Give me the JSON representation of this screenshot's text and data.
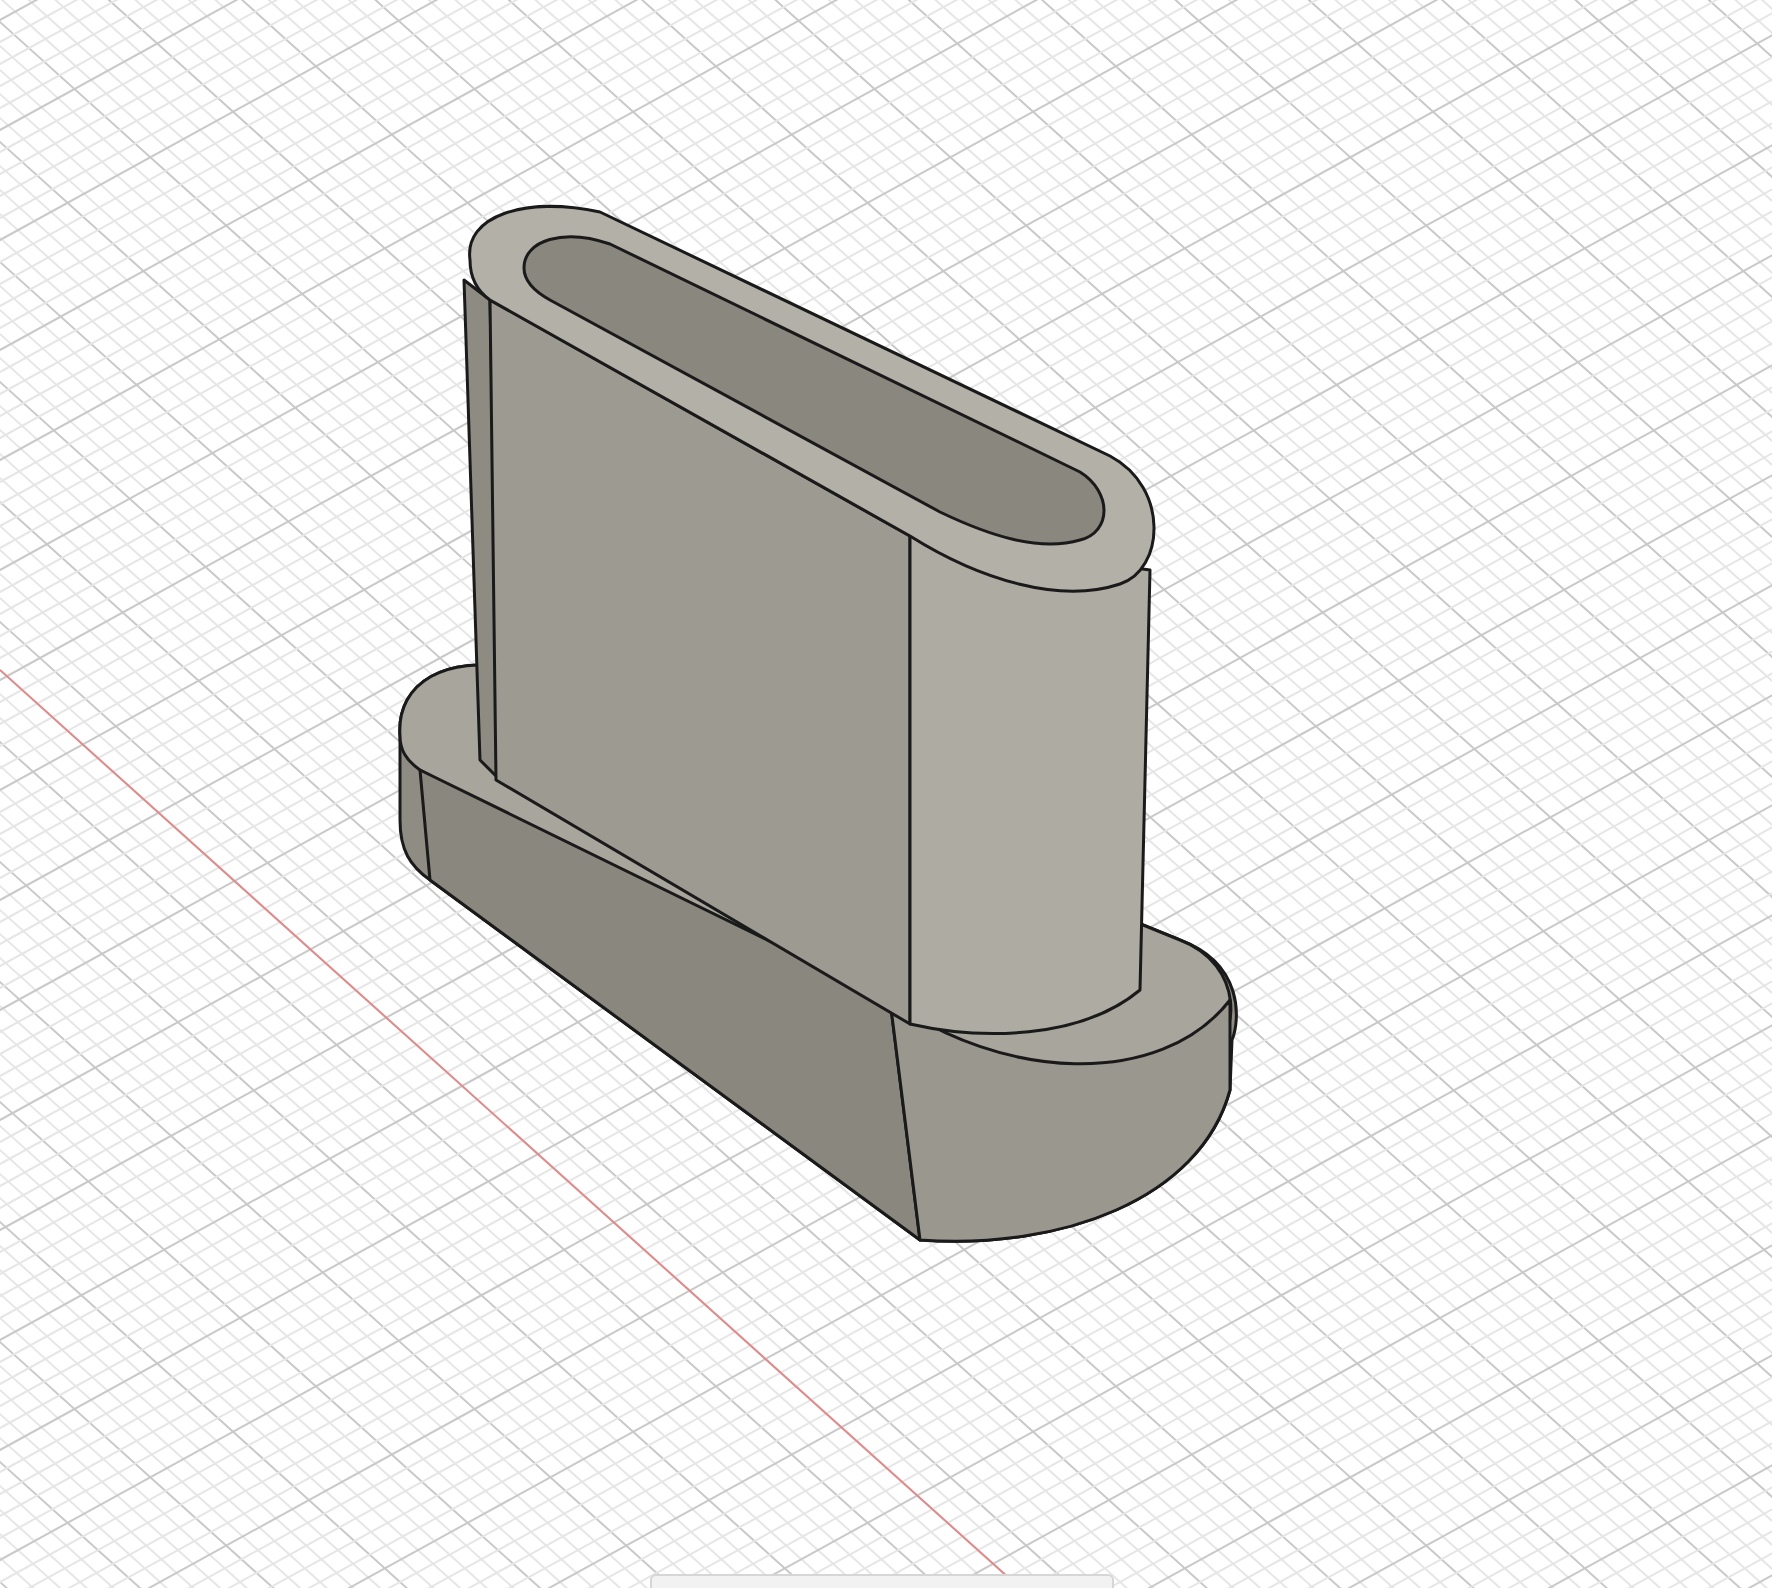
{
  "viewport": {
    "grid_visible": true
  },
  "toolbar": {
    "visible": true
  }
}
